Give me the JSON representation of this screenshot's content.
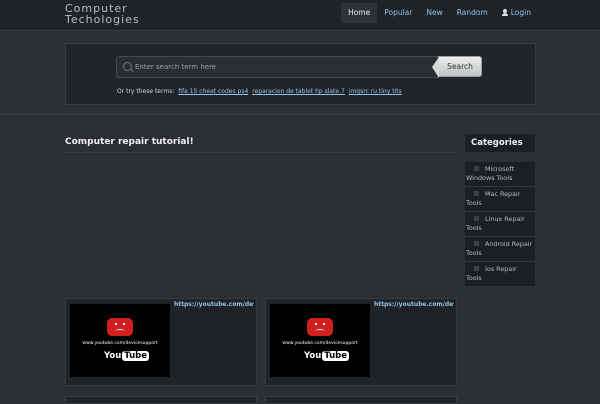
{
  "header": {
    "brand": "Computer Techologies",
    "nav": [
      {
        "label": "Home"
      },
      {
        "label": "Popular"
      },
      {
        "label": "New"
      },
      {
        "label": "Random"
      },
      {
        "label": "Login"
      }
    ]
  },
  "search": {
    "placeholder": "Enter search term here",
    "button_label": "Search",
    "try_prefix": "Or try these terms:",
    "terms": [
      "fifa 15 cheat codes ps4",
      "reparacion de tablet hp slate 7",
      "imgsrc ru tiny tits"
    ]
  },
  "main": {
    "title": "Computer repair tutorial!",
    "videos": [
      {
        "link": "https://youtube.com/devi",
        "thumb_url_text": "www.youtube.com/devicesupport"
      },
      {
        "link": "https://youtube.com/devi",
        "thumb_url_text": "www.youtube.com/devicesupport"
      }
    ],
    "youtube_logo": {
      "you": "You",
      "tube": "Tube"
    }
  },
  "sidebar": {
    "title": "Categories",
    "items": [
      {
        "label": "Microsoft Windows Tools"
      },
      {
        "label": "Mac Repair Tools"
      },
      {
        "label": "Linux Repair Tools"
      },
      {
        "label": "Android Repair Tools"
      },
      {
        "label": "Ios Repair Tools"
      }
    ]
  },
  "colors": {
    "background": "#2b2e33",
    "link": "#8fc3ea",
    "youtube_red": "#d11f1f"
  }
}
